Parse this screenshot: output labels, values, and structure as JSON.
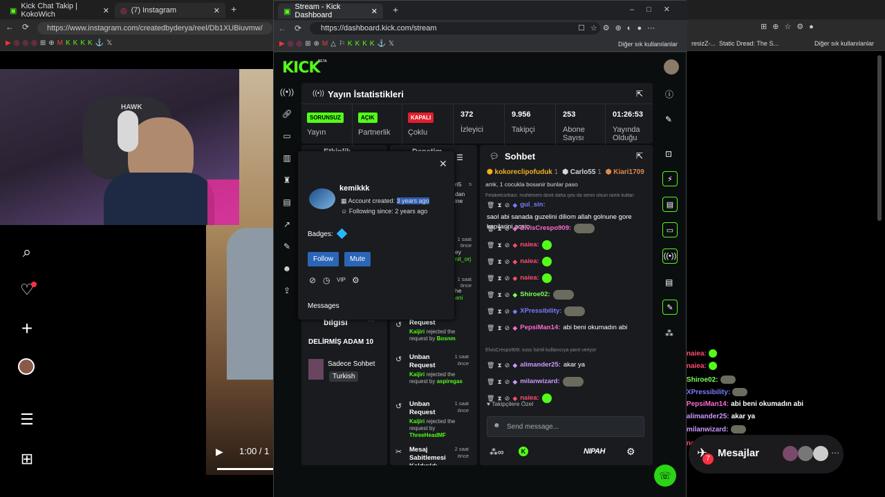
{
  "bg_browser": {
    "tabs": [
      "Kick Chat Takip | KokoWich",
      "(7) Instagram"
    ],
    "url": "https://www.instagram.com/createdbyderya/reel/Db1XUBiuvmw/",
    "bookmarks_right": [
      "Diğer sık kullanılanlar",
      "Static Dread: The S...",
      "Diğer sık kullanılanlar"
    ],
    "video_time": "1:00 / 1"
  },
  "kick_browser": {
    "tab_title": "Stream - Kick Dashboard",
    "url": "https://dashboard.kick.com/stream",
    "bookmark_other": "Diğer sık kullanılanlar"
  },
  "kick": {
    "logo": "KICK",
    "logo_beta": "BETA",
    "stats_title": "Yayın İstatistikleri",
    "stats": [
      {
        "badge": "SORUNSUZ",
        "label": "Yayın"
      },
      {
        "badge": "AÇIK",
        "label": "Partnerlik"
      },
      {
        "badge": "KAPALI",
        "label": "Çoklu"
      },
      {
        "value": "372",
        "label": "İzleyici"
      },
      {
        "value": "9.956",
        "label": "Takipçi"
      },
      {
        "value": "253",
        "label": "Abone Sayısı"
      },
      {
        "value": "01:26:53",
        "label": "Yayında Olduğu"
      }
    ],
    "col1_title": "Etkinlik",
    "col2_title": "Denetim",
    "popup": {
      "username": "kemikkk",
      "account_created_label": "Account created:",
      "account_created": "3 years ago",
      "following_since": "Following since: 2 years ago",
      "badges_label": "Badges:",
      "follow": "Follow",
      "mute": "Mute",
      "messages": "Messages"
    },
    "left_panel": {
      "info": "bilgisi",
      "stream_title": "DELİRMİŞ ADAM 10",
      "category": "Sadece Sohbet",
      "tag": "Turkish"
    },
    "moderation_fragments": [
      {
        "text": "ri5",
        "time": "s",
        "t2": "ör"
      },
      {
        "text": "dan",
        "time": ""
      },
      {
        "text": "ine",
        "time": ""
      },
      {
        "text": "",
        "time": "1 saat önce"
      },
      {
        "text": "ey",
        "time": ""
      },
      {
        "text": "nit_orj",
        "time": ""
      },
      {
        "text": "",
        "time": "1 saat önce"
      },
      {
        "text": "he",
        "time": ""
      },
      {
        "text": "ani",
        "time": ""
      }
    ],
    "moderation_items": [
      {
        "title": "Request",
        "mod": "Kaijiri",
        "desc": "rejected the request by",
        "user": "Bosnm",
        "time": ""
      },
      {
        "title": "Unban Request",
        "mod": "Kaijiri",
        "desc": "rejected the request by",
        "user": "aspiregas",
        "time": "1 saat önce"
      },
      {
        "title": "Unban Request",
        "mod": "Kaijiri",
        "desc": "rejected the request by",
        "user": "ThreeHeadMF",
        "time": "1 saat önce"
      },
      {
        "title": "Mesaj Sabitlemesi Kaldırıldı",
        "mod": "",
        "desc": "",
        "user": "",
        "time": "2 saat önce"
      }
    ],
    "chat": {
      "title": "Sohbet",
      "top_gifters": [
        "kokoreclipofuduk",
        "Carlo55",
        "Kiari1709"
      ],
      "gifter_counts": [
        "1",
        "1",
        ""
      ],
      "partial_line": "amk, 1 cocukla bosanir bunlar paso",
      "reply_note_1": "Felaketcorbaci: muhtesem dosti daha iyisi da senin olsun isimli kullan",
      "messages": [
        {
          "user": "gul_sin",
          "color": "#7b7bff",
          "text": "saol abi sanada guzelini diliom allah golnune gore kapilarini acsin"
        },
        {
          "user": "ElvisCrespo909",
          "color": "#ff6bd0",
          "text": ""
        },
        {
          "user": "naiea",
          "color": "#ff4d6d",
          "text": ""
        },
        {
          "user": "naiea",
          "color": "#ff4d6d",
          "text": ""
        },
        {
          "user": "naiea",
          "color": "#ff4d6d",
          "text": ""
        },
        {
          "user": "Shiroe02",
          "color": "#7dff5a",
          "text": ""
        },
        {
          "user": "XPressibility",
          "color": "#7b7bff",
          "text": ""
        },
        {
          "user": "PepsiMan14",
          "color": "#ff6bd0",
          "text": "abi beni okumadın abi"
        }
      ],
      "reply_note_2": "ElvisCrespo909: suss  İsimli kullanıcıya yanıt veriyor",
      "messages2": [
        {
          "user": "alimander25",
          "color": "#c99bff",
          "text": "akar ya"
        },
        {
          "user": "milanwizard",
          "color": "#c99bff",
          "text": ""
        },
        {
          "user": "naiea",
          "color": "#ff4d6d",
          "text": ""
        }
      ],
      "followers_only": "Takipçilere Özel",
      "input_placeholder": "Send message...",
      "nipah": "NIPAH"
    }
  },
  "right_chat": [
    {
      "user": "naiea",
      "color": "#ff4d6d",
      "text": ""
    },
    {
      "user": "naiea",
      "color": "#ff4d6d",
      "text": ""
    },
    {
      "user": "Shiroe02",
      "color": "#7dff5a",
      "text": ""
    },
    {
      "user": "XPressibility",
      "color": "#7b7bff",
      "text": ""
    },
    {
      "user": "PepsiMan14",
      "color": "#ff6bd0",
      "text": "abi beni okumadın abi"
    },
    {
      "user": "alimander25",
      "color": "#c99bff",
      "text": "akar ya"
    },
    {
      "user": "milanwizard",
      "color": "#c99bff",
      "text": ""
    },
    {
      "user": "naiea",
      "color": "#ff4d6d",
      "text": ""
    }
  ],
  "messages_widget": {
    "label": "Mesajlar",
    "count": "7"
  },
  "colors": {
    "kick_green": "#53fc18",
    "page_bg": "#0b0e0f",
    "panel": "#191b1f"
  }
}
